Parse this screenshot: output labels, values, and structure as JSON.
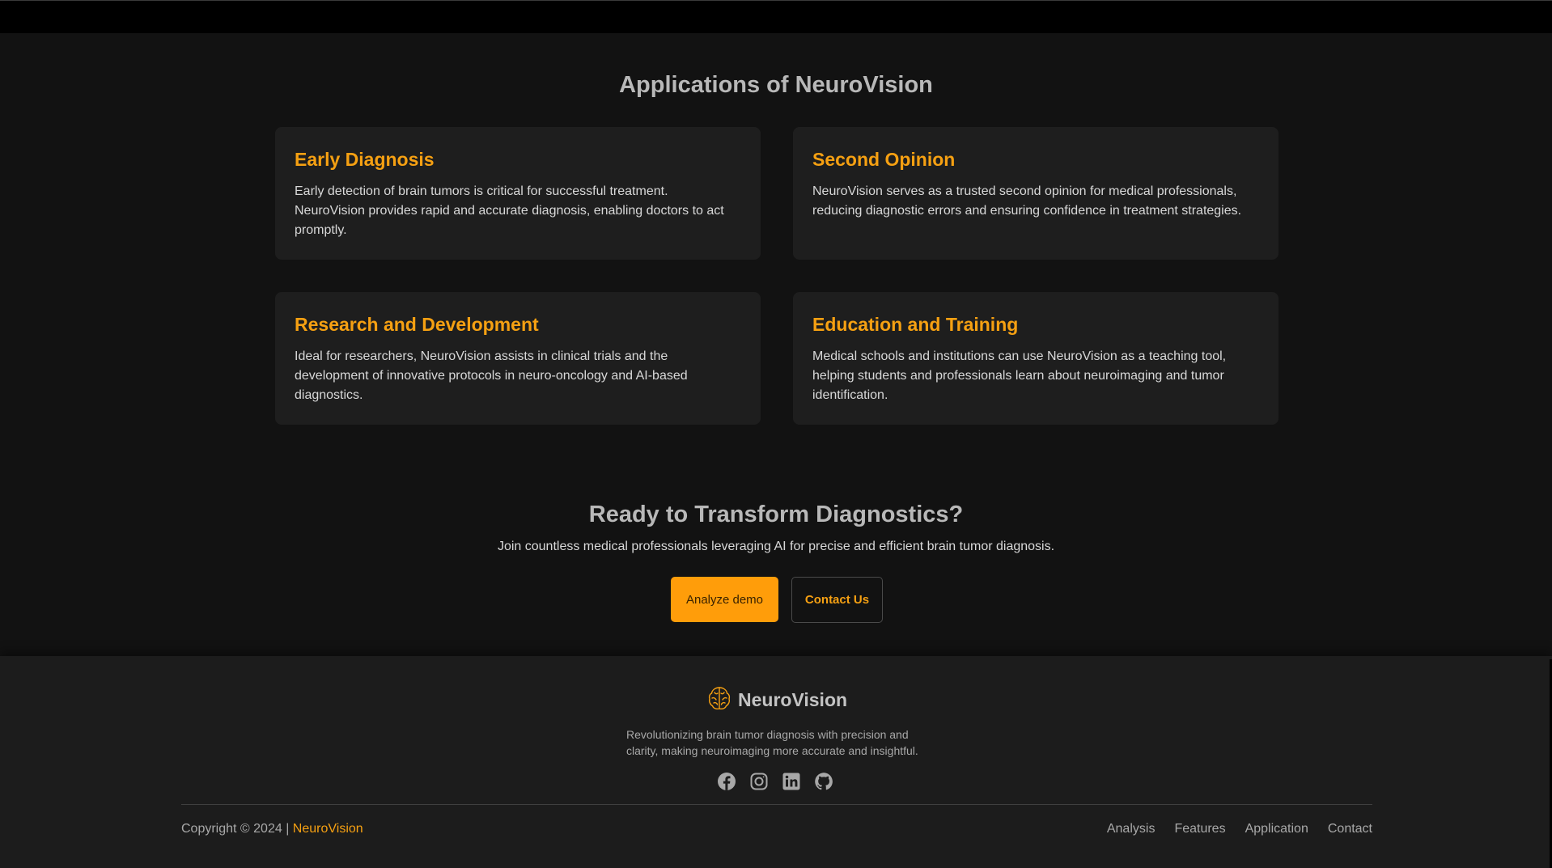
{
  "applications": {
    "title": "Applications of NeuroVision",
    "cards": [
      {
        "title": "Early Diagnosis",
        "text": "Early detection of brain tumors is critical for successful treatment. NeuroVision provides rapid and accurate diagnosis, enabling doctors to act promptly."
      },
      {
        "title": "Second Opinion",
        "text": "NeuroVision serves as a trusted second opinion for medical professionals, reducing diagnostic errors and ensuring confidence in treatment strategies."
      },
      {
        "title": "Research and Development",
        "text": "Ideal for researchers, NeuroVision assists in clinical trials and the development of innovative protocols in neuro-oncology and AI-based diagnostics."
      },
      {
        "title": "Education and Training",
        "text": "Medical schools and institutions can use NeuroVision as a teaching tool, helping students and professionals learn about neuroimaging and tumor identification."
      }
    ]
  },
  "cta": {
    "title": "Ready to Transform Diagnostics?",
    "subtitle": "Join countless medical professionals leveraging AI for precise and efficient brain tumor diagnosis.",
    "primary_button": "Analyze demo",
    "secondary_button": "Contact Us"
  },
  "footer": {
    "brand": "NeuroVision",
    "brand_icon": "brain-icon",
    "description": "Revolutionizing brain tumor diagnosis with precision and clarity, making neuroimaging more accurate and insightful.",
    "social_icons": [
      "facebook-icon",
      "instagram-icon",
      "linkedin-icon",
      "github-icon"
    ],
    "copyright_prefix": "Copyright © 2024 | ",
    "copyright_brand": "NeuroVision",
    "nav": [
      "Analysis",
      "Features",
      "Application",
      "Contact"
    ]
  },
  "colors": {
    "accent": "#f5a012",
    "background": "#121212",
    "card": "#1e1e1e",
    "footer": "#1c1c1c"
  }
}
